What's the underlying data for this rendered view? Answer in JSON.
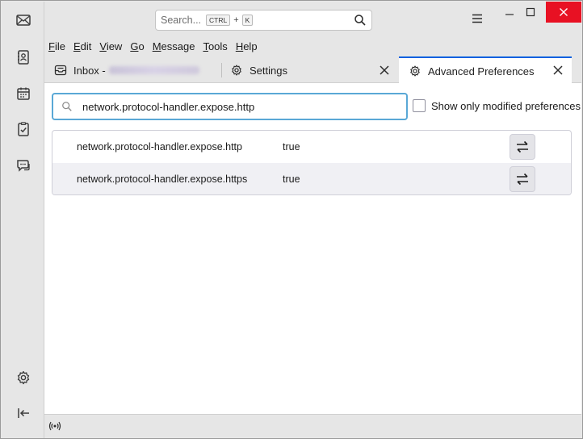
{
  "search": {
    "placeholder": "Search...",
    "shortcut_key1": "CTRL",
    "shortcut_plus": "+",
    "shortcut_key2": "K"
  },
  "menubar": {
    "items": [
      {
        "ul": "F",
        "rest": "ile"
      },
      {
        "ul": "E",
        "rest": "dit"
      },
      {
        "ul": "V",
        "rest": "iew"
      },
      {
        "ul": "G",
        "rest": "o"
      },
      {
        "ul": "M",
        "rest": "essage"
      },
      {
        "ul": "T",
        "rest": "ools"
      },
      {
        "ul": "H",
        "rest": "elp"
      }
    ]
  },
  "tabs": [
    {
      "label": "Inbox -",
      "icon": "inbox-icon"
    },
    {
      "label": "Settings",
      "icon": "gear-icon"
    },
    {
      "label": "Advanced Preferences",
      "icon": "gear-icon"
    }
  ],
  "prefs": {
    "search_value": "network.protocol-handler.expose.http",
    "show_modified_label": "Show only modified preferences",
    "rows": [
      {
        "name": "network.protocol-handler.expose.http",
        "value": "true"
      },
      {
        "name": "network.protocol-handler.expose.https",
        "value": "true"
      }
    ]
  },
  "colors": {
    "accent": "#0060df",
    "focus_ring": "#5aa8d6",
    "close_red": "#e81123"
  }
}
